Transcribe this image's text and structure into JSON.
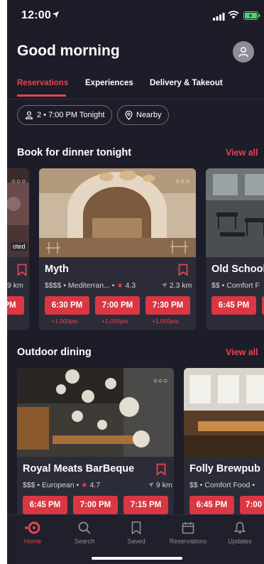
{
  "status": {
    "time": "12:00"
  },
  "header": {
    "greeting": "Good morning"
  },
  "tabs": [
    {
      "label": "Reservations",
      "active": true
    },
    {
      "label": "Experiences",
      "active": false
    },
    {
      "label": "Delivery & Takeout",
      "active": false
    }
  ],
  "filters": {
    "party": "2 • 7:00 PM Tonight",
    "location": "Nearby"
  },
  "sections": {
    "dinner": {
      "title": "Book for dinner tonight",
      "view_all": "View all",
      "partial_left": {
        "badge": "oted",
        "dist": "9 km",
        "slot": "PM"
      },
      "main": {
        "name": "Myth",
        "meta_prefix": "$$$$ • Mediterran... •",
        "rating": "4.3",
        "distance": "2.3 km",
        "slots": [
          {
            "time": "6:30 PM",
            "points": "+1,000pts"
          },
          {
            "time": "7:00 PM",
            "points": "+1,000pts"
          },
          {
            "time": "7:30 PM",
            "points": "+1,000pts"
          }
        ]
      },
      "partial_right": {
        "name": "Old School",
        "meta": "$$ • Comfort F",
        "slot": "6:45 PM"
      }
    },
    "outdoor": {
      "title": "Outdoor dining",
      "view_all": "View all",
      "main": {
        "name": "Royal Meats BarBeque",
        "meta_prefix": "$$$ • European •",
        "rating": "4.7",
        "distance": "9 km",
        "slots": [
          {
            "time": "6:45 PM"
          },
          {
            "time": "7:00 PM"
          },
          {
            "time": "7:15 PM"
          }
        ]
      },
      "partial_right": {
        "name": "Folly Brewpub",
        "meta": "$$ • Comfort Food •",
        "slots": [
          "6:45 PM",
          "7:00"
        ]
      }
    }
  },
  "bottom_nav": [
    {
      "label": "Home",
      "icon": "home-icon",
      "active": true
    },
    {
      "label": "Search",
      "icon": "search-icon",
      "active": false
    },
    {
      "label": "Saved",
      "icon": "bookmark-icon",
      "active": false
    },
    {
      "label": "Reservations",
      "icon": "calendar-icon",
      "active": false
    },
    {
      "label": "Updates",
      "icon": "bell-icon",
      "active": false
    }
  ],
  "colors": {
    "accent": "#da3743",
    "background": "#1c1d28",
    "card": "#2b2c38"
  }
}
